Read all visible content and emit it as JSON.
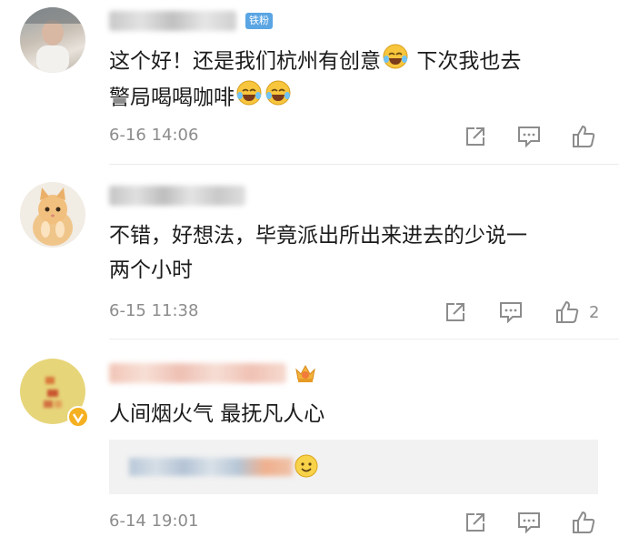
{
  "comments": [
    {
      "badge": "铁粉",
      "text_line1_a": "这个好！还是我们杭州有创意",
      "text_line1_b": "下次我也去",
      "text_line2": "警局喝喝咖啡",
      "date": "6-16 14:06",
      "like_count": ""
    },
    {
      "text_line1": "不错，好想法，毕竟派出所出来进去的少说一",
      "text_line2": "两个小时",
      "date": "6-15 11:38",
      "like_count": "2"
    },
    {
      "text_line1": "人间烟火气 最抚凡人心",
      "date": "6-14 19:01",
      "like_count": ""
    }
  ],
  "icons": [
    "share-icon",
    "comment-icon",
    "like-icon",
    "laugh-cry-emoji",
    "smile-emoji",
    "crown-icon",
    "verified-icon"
  ],
  "colors": {
    "meta": "#8c8c8c",
    "badge": "#5aa5e3",
    "verified": "#f5b021",
    "reply_bg": "#f2f2f2"
  }
}
